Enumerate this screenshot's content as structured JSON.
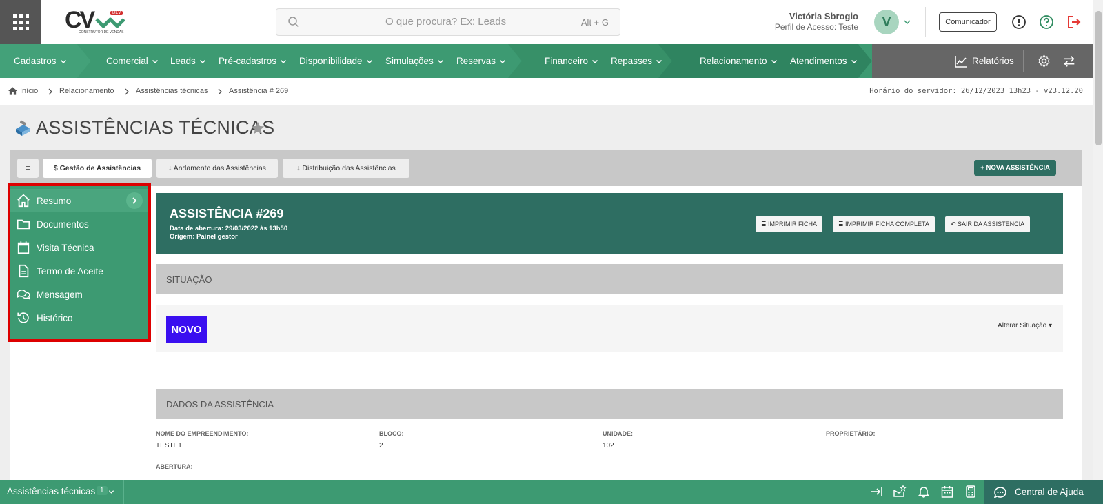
{
  "header": {
    "logo_text": "CV",
    "logo_badge": "DEV",
    "logo_subtitle": "CONSTRUTOR DE VENDAS",
    "search_placeholder": "O que procura? Ex: Leads",
    "search_shortcut": "Alt + G",
    "user_name": "Victória Sbrogio",
    "user_profile": "Perfil de Acesso: Teste",
    "avatar_letter": "V",
    "comunicador_label": "Comunicador"
  },
  "nav": {
    "items": [
      {
        "label": "Cadastros"
      },
      {
        "label": "Comercial"
      },
      {
        "label": "Leads"
      },
      {
        "label": "Pré-cadastros"
      },
      {
        "label": "Disponibilidade"
      },
      {
        "label": "Simulações"
      },
      {
        "label": "Reservas"
      },
      {
        "label": "Financeiro"
      },
      {
        "label": "Repasses"
      },
      {
        "label": "Relacionamento"
      },
      {
        "label": "Atendimentos"
      }
    ],
    "reports_label": "Relatórios"
  },
  "breadcrumb": {
    "items": [
      "Início",
      "Relacionamento",
      "Assistências técnicas",
      "Assistência # 269"
    ],
    "server_time": "Horário do servidor: 26/12/2023 13h23 - v23.12.20"
  },
  "page": {
    "title": "ASSISTÊNCIAS TÉCNICAS"
  },
  "tabs": {
    "menu_glyph": "≡",
    "items": [
      {
        "label": "$ Gestão de Assistências"
      },
      {
        "label": "↓ Andamento das Assistências"
      },
      {
        "label": "↓ Distribuição das Assistências"
      }
    ],
    "new_button": "+ NOVA ASSISTÊNCIA"
  },
  "sidemenu": {
    "items": [
      {
        "label": "Resumo",
        "icon": "home-icon"
      },
      {
        "label": "Documentos",
        "icon": "folder-icon"
      },
      {
        "label": "Visita Técnica",
        "icon": "calendar-icon"
      },
      {
        "label": "Termo de Aceite",
        "icon": "document-icon"
      },
      {
        "label": "Mensagem",
        "icon": "chat-icon"
      },
      {
        "label": "Histórico",
        "icon": "history-icon"
      }
    ]
  },
  "assistance": {
    "title": "ASSISTÊNCIA #269",
    "opened": "Data de abertura: 29/03/2022 às 13h50",
    "origin": "Origem: Painel gestor",
    "buttons": [
      "≣ IMPRIMIR FICHA",
      "≣ IMPRIMIR FICHA COMPLETA",
      "↶ SAIR DA ASSISTÊNCIA"
    ]
  },
  "situation": {
    "header": "SITUAÇÃO",
    "status": "NOVO",
    "status_color": "#3a0ff0",
    "change_label": "Alterar Situação ▾"
  },
  "details": {
    "header": "DADOS DA ASSISTÊNCIA",
    "fields": [
      {
        "label": "NOME DO EMPREENDIMENTO:",
        "value": "TESTE1"
      },
      {
        "label": "BLOCO:",
        "value": "2"
      },
      {
        "label": "UNIDADE:",
        "value": "102"
      },
      {
        "label": "PROPRIETÁRIO:",
        "value": ""
      }
    ],
    "next_label": "ABERTURA:"
  },
  "bottombar": {
    "title": "Assistências técnicas",
    "count": "1",
    "help_label": "Central de Ajuda"
  },
  "colors": {
    "brand_green": "#3d9a72",
    "dark_teal": "#2e6e62",
    "highlight_red": "#dd0000"
  }
}
